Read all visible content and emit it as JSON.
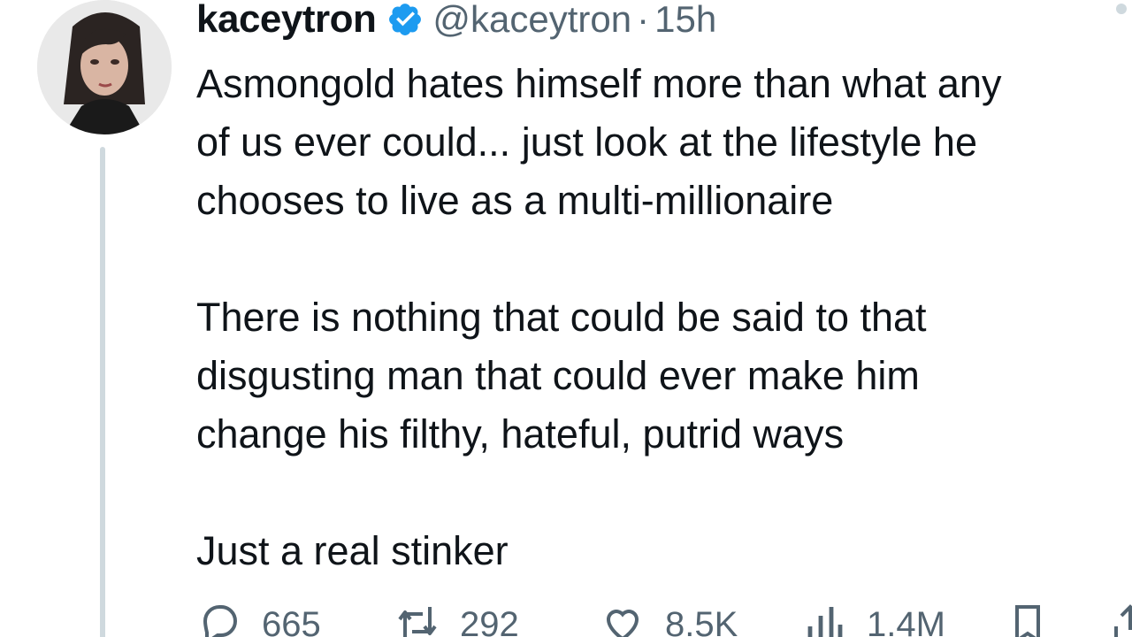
{
  "author": {
    "display_name": "kaceytron",
    "handle": "@kaceytron",
    "separator": "·",
    "timestamp": "15h",
    "verified": true,
    "verified_color": "#1d9bf0"
  },
  "tweet": {
    "paragraphs": [
      [
        "Asmongold hates himself more than what any",
        "of us ever could... just look at the lifestyle he",
        "chooses to live as a multi-millionaire"
      ],
      [
        "There is nothing that could be said to that",
        "disgusting man that could ever make him",
        "change his filthy, hateful, putrid ways"
      ],
      [
        "Just a real stinker"
      ]
    ]
  },
  "actions": {
    "replies": "665",
    "retweets": "292",
    "likes": "8.5K",
    "views": "1.4M"
  },
  "icons": [
    "more-icon",
    "verified-badge-icon",
    "reply-icon",
    "retweet-icon",
    "like-icon",
    "views-icon",
    "bookmark-icon",
    "share-icon"
  ],
  "colors": {
    "text": "#0f1419",
    "secondary": "#536471",
    "thread_line": "#cfd9de"
  }
}
